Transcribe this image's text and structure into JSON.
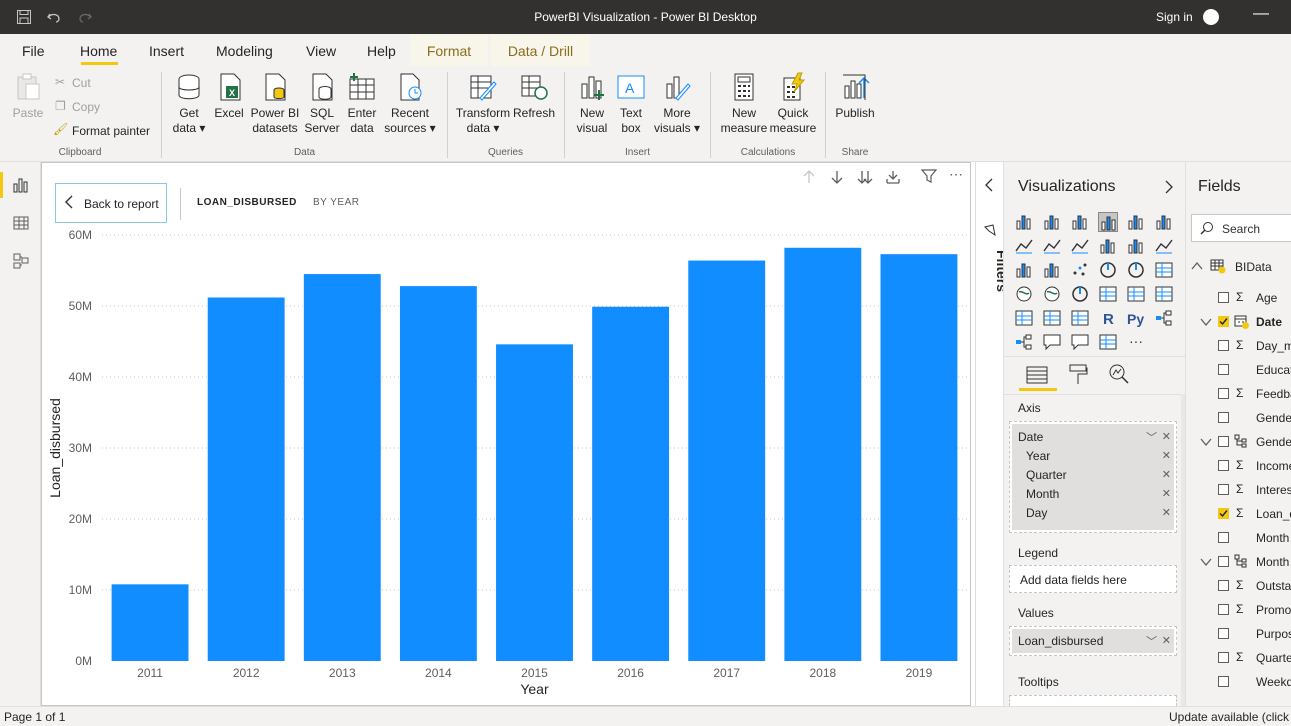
{
  "titlebar": {
    "title": "PowerBI Visualization - Power BI Desktop",
    "signin": "Sign in"
  },
  "menu": {
    "file": "File",
    "home": "Home",
    "insert": "Insert",
    "modeling": "Modeling",
    "view": "View",
    "help": "Help",
    "format": "Format",
    "data_drill": "Data / Drill"
  },
  "ribbon": {
    "paste": "Paste",
    "cut": "Cut",
    "copy": "Copy",
    "format_painter": "Format painter",
    "clipboard": "Clipboard",
    "get_data": [
      "Get",
      "data"
    ],
    "excel": "Excel",
    "powerbi_datasets": [
      "Power BI",
      "datasets"
    ],
    "sql_server": [
      "SQL",
      "Server"
    ],
    "enter_data": [
      "Enter",
      "data"
    ],
    "recent_sources": [
      "Recent",
      "sources"
    ],
    "data": "Data",
    "transform_data": [
      "Transform",
      "data"
    ],
    "refresh": "Refresh",
    "queries": "Queries",
    "new_visual": [
      "New",
      "visual"
    ],
    "text_box": [
      "Text",
      "box"
    ],
    "more_visuals": [
      "More",
      "visuals"
    ],
    "insert": "Insert",
    "new_measure": [
      "New",
      "measure"
    ],
    "quick_measure": [
      "Quick",
      "measure"
    ],
    "calculations": "Calculations",
    "publish": "Publish",
    "share": "Share"
  },
  "visual": {
    "back_label": "Back to report",
    "header_field": "LOAN_DISBURSED",
    "header_by": "BY YEAR"
  },
  "chart_data": {
    "type": "bar",
    "categories": [
      "2011",
      "2012",
      "2013",
      "2014",
      "2015",
      "2016",
      "2017",
      "2018",
      "2019"
    ],
    "values": [
      10.8,
      51.2,
      54.5,
      52.8,
      44.6,
      49.9,
      56.4,
      58.2,
      57.3
    ],
    "ylim": [
      0,
      60
    ],
    "yticks": [
      "0M",
      "10M",
      "20M",
      "30M",
      "40M",
      "50M",
      "60M"
    ],
    "ytick_values": [
      0,
      10,
      20,
      30,
      40,
      50,
      60
    ],
    "xlabel": "Year",
    "ylabel": "Loan_disbursed",
    "color": "#118DFF",
    "grid": true
  },
  "filters": {
    "label": "Filters"
  },
  "viz": {
    "title": "Visualizations",
    "axis_label": "Axis",
    "axis_field": "Date",
    "axis_items": [
      "Year",
      "Quarter",
      "Month",
      "Day"
    ],
    "legend_label": "Legend",
    "legend_placeholder": "Add data fields here",
    "values_label": "Values",
    "values_field": "Loan_disbursed",
    "tooltips_label": "Tooltips"
  },
  "fields": {
    "title": "Fields",
    "search_placeholder": "Search",
    "table": "BIData",
    "items": [
      {
        "label": "Age",
        "sigma": true,
        "checked": false,
        "kind": "field"
      },
      {
        "label": "Date",
        "sigma": false,
        "checked": true,
        "kind": "hier"
      },
      {
        "label": "Day_m",
        "sigma": true,
        "checked": false,
        "kind": "field"
      },
      {
        "label": "Educat",
        "sigma": false,
        "checked": false,
        "kind": "field"
      },
      {
        "label": "Feedba",
        "sigma": true,
        "checked": false,
        "kind": "field"
      },
      {
        "label": "Gende",
        "sigma": false,
        "checked": false,
        "kind": "field"
      },
      {
        "label": "Gende",
        "sigma": false,
        "checked": false,
        "kind": "hier2"
      },
      {
        "label": "Income",
        "sigma": true,
        "checked": false,
        "kind": "field"
      },
      {
        "label": "Interes",
        "sigma": true,
        "checked": false,
        "kind": "field"
      },
      {
        "label": "Loan_d",
        "sigma": true,
        "checked": true,
        "kind": "field"
      },
      {
        "label": "Month",
        "sigma": false,
        "checked": false,
        "kind": "field"
      },
      {
        "label": "Month",
        "sigma": false,
        "checked": false,
        "kind": "hier2"
      },
      {
        "label": "Outsta",
        "sigma": true,
        "checked": false,
        "kind": "field"
      },
      {
        "label": "Promo",
        "sigma": true,
        "checked": false,
        "kind": "field"
      },
      {
        "label": "Purpos",
        "sigma": false,
        "checked": false,
        "kind": "field"
      },
      {
        "label": "Quarte",
        "sigma": true,
        "checked": false,
        "kind": "field"
      },
      {
        "label": "Weekd",
        "sigma": false,
        "checked": false,
        "kind": "field"
      }
    ]
  },
  "status": {
    "page": "Page 1 of 1",
    "update": "Update available (click"
  }
}
